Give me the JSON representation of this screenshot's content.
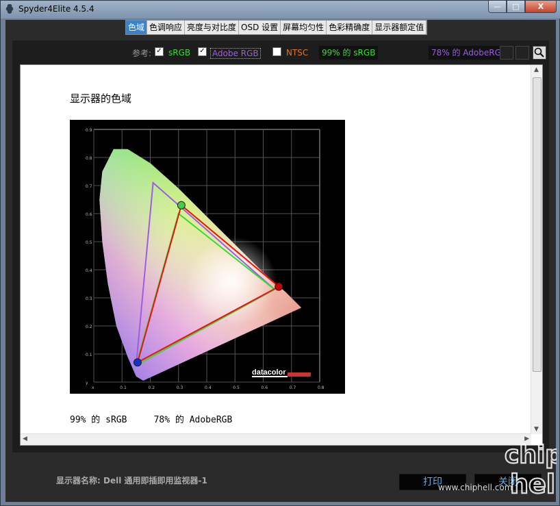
{
  "window": {
    "title": "Spyder4Elite 4.5.4",
    "minimize": "—",
    "maximize": "□",
    "close": "X"
  },
  "tabs": [
    "色域",
    "色调响应",
    "亮度与对比度",
    "OSD 设置",
    "屏幕均匀性",
    "色彩精确度",
    "显示器额定值"
  ],
  "reference": {
    "label": "参考:",
    "srgb": {
      "label": "sRGB",
      "checked": true,
      "color": "#3cd93c"
    },
    "adobe": {
      "label": "Adobe RGB",
      "checked": true,
      "color": "#9b5de5"
    },
    "ntsc": {
      "label": "NTSC",
      "checked": false,
      "color": "#e8721c"
    },
    "srgb_stat": "99% 的 sRGB",
    "adobe_stat": "78% 的 AdobeRGB"
  },
  "content": {
    "heading": "显示器的色域",
    "results": "99% 的 sRGB     78% 的 AdobeRGB"
  },
  "chart": {
    "brand": "datacolor",
    "y_ticks": [
      "0.9",
      "0.8",
      "0.7",
      "0.6",
      "0.5",
      "0.4",
      "0.3",
      "0.2",
      "0.1",
      "y"
    ],
    "x_ticks": [
      "x",
      "0.1",
      "0.2",
      "0.3",
      "0.4",
      "0.5",
      "0.6",
      "0.7",
      "0.8"
    ]
  },
  "chart_data": {
    "type": "scatter",
    "title": "",
    "xlabel": "x",
    "ylabel": "y",
    "xlim": [
      0,
      0.8
    ],
    "ylim": [
      0,
      0.9
    ],
    "series": [
      {
        "name": "sRGB",
        "color": "#33dd33",
        "points": [
          [
            0.64,
            0.33
          ],
          [
            0.3,
            0.6
          ],
          [
            0.15,
            0.06
          ]
        ]
      },
      {
        "name": "Adobe RGB",
        "color": "#9b5de5",
        "points": [
          [
            0.64,
            0.33
          ],
          [
            0.21,
            0.71
          ],
          [
            0.15,
            0.06
          ]
        ]
      },
      {
        "color": "#ee1111",
        "points": [
          [
            0.655,
            0.34
          ],
          [
            0.31,
            0.63
          ],
          [
            0.155,
            0.07
          ]
        ]
      }
    ]
  },
  "footer": {
    "monitor_label": "显示器名称: Dell 通用即插即用监视器-1",
    "print": "打印",
    "close": "关闭"
  },
  "watermark": {
    "url": "www.chiphell.com"
  }
}
